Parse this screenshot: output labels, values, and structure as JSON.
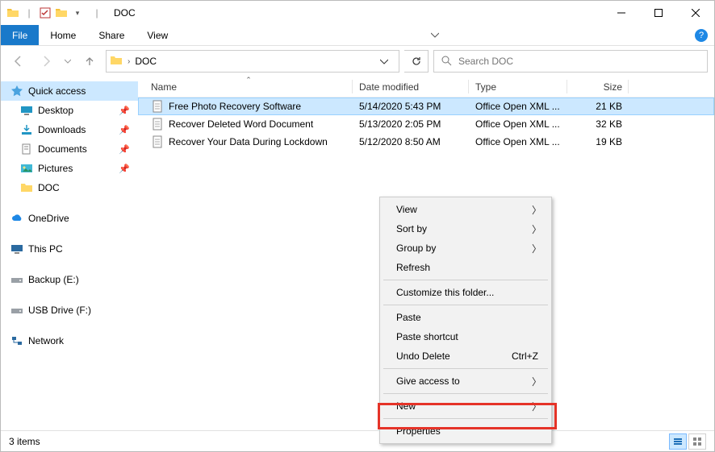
{
  "window": {
    "title": "DOC"
  },
  "menu": {
    "file": "File",
    "home": "Home",
    "share": "Share",
    "view": "View"
  },
  "address": {
    "crumb": "DOC"
  },
  "search": {
    "placeholder": "Search DOC"
  },
  "sidebar": {
    "quick_access": "Quick access",
    "items": [
      {
        "label": "Desktop"
      },
      {
        "label": "Downloads"
      },
      {
        "label": "Documents"
      },
      {
        "label": "Pictures"
      },
      {
        "label": "DOC"
      }
    ],
    "onedrive": "OneDrive",
    "thispc": "This PC",
    "backup": "Backup (E:)",
    "usb": "USB Drive (F:)",
    "network": "Network"
  },
  "columns": {
    "name": "Name",
    "date": "Date modified",
    "type": "Type",
    "size": "Size"
  },
  "files": [
    {
      "name": "Free Photo Recovery Software",
      "date": "5/14/2020 5:43 PM",
      "type": "Office Open XML ...",
      "size": "21 KB"
    },
    {
      "name": "Recover Deleted Word Document",
      "date": "5/13/2020 2:05 PM",
      "type": "Office Open XML ...",
      "size": "32 KB"
    },
    {
      "name": "Recover Your Data During Lockdown",
      "date": "5/12/2020 8:50 AM",
      "type": "Office Open XML ...",
      "size": "19 KB"
    }
  ],
  "context_menu": {
    "view": "View",
    "sort": "Sort by",
    "group": "Group by",
    "refresh": "Refresh",
    "customize": "Customize this folder...",
    "paste": "Paste",
    "paste_shortcut": "Paste shortcut",
    "undo": "Undo Delete",
    "undo_key": "Ctrl+Z",
    "access": "Give access to",
    "new": "New",
    "properties": "Properties"
  },
  "status": {
    "count": "3 items"
  }
}
